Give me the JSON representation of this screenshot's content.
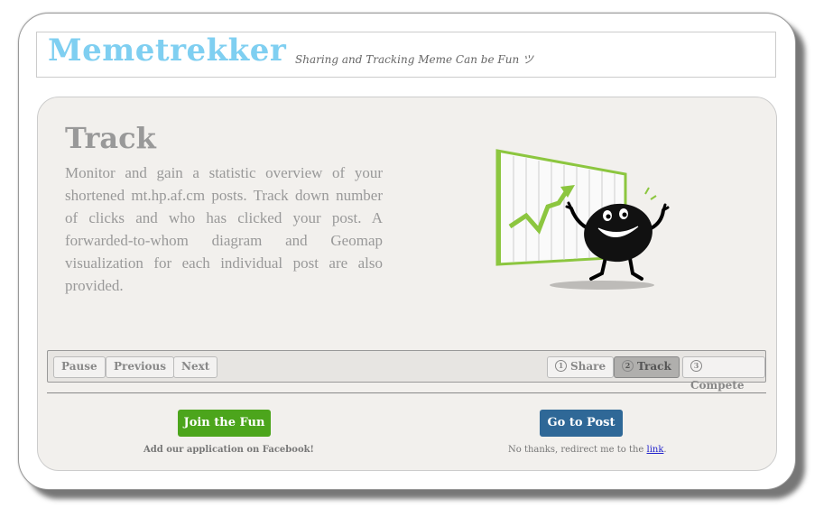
{
  "header": {
    "logo": "Memetrekker",
    "tagline": "Sharing and Tracking Meme Can be Fun ツ"
  },
  "slide": {
    "title": "Track",
    "description": "Monitor and gain a statistic overview of your shortened mt.hp.af.cm posts. Track down number of clicks and who has clicked your post. A forwarded-to-whom diagram and Geomap visualization for each individual post are also provided."
  },
  "nav": {
    "pause": "Pause",
    "previous": "Previous",
    "next": "Next",
    "steps": [
      {
        "num": "1",
        "label": "Share"
      },
      {
        "num": "2",
        "label": "Track"
      },
      {
        "num": "3",
        "label": "Compete"
      }
    ],
    "active_step": "Track"
  },
  "actions": {
    "join_label": "Join the Fun",
    "join_caption": "Add our application on Facebook!",
    "goto_label": "Go to Post",
    "goto_caption_prefix": "No thanks, redirect me to the ",
    "goto_caption_link": "link",
    "goto_caption_suffix": "."
  },
  "colors": {
    "logo": "#7fcff1",
    "join_button": "#4ca51c",
    "goto_button": "#2f6897",
    "chart_green": "#8cc63f"
  },
  "illustration_icon": "happy-chart-character-icon"
}
